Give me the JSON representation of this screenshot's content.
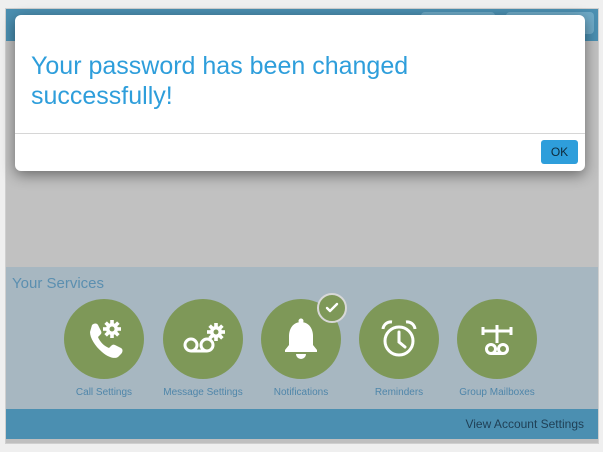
{
  "modal": {
    "message": "Your password has been changed successfully!",
    "ok_label": "OK"
  },
  "services": {
    "title": "Your Services",
    "items": [
      {
        "label": "Call Settings",
        "icon": "phone-gear-icon"
      },
      {
        "label": "Message Settings",
        "icon": "voicemail-gear-icon"
      },
      {
        "label": "Notifications",
        "icon": "bell-icon",
        "checked": true
      },
      {
        "label": "Reminders",
        "icon": "alarm-clock-icon"
      },
      {
        "label": "Group Mailboxes",
        "icon": "group-mailbox-icon"
      }
    ]
  },
  "footer": {
    "account_link": "View Account Settings"
  },
  "colors": {
    "accent_blue": "#2e9edb",
    "bar_blue": "#4b8fb1",
    "service_green": "#7e9858"
  }
}
